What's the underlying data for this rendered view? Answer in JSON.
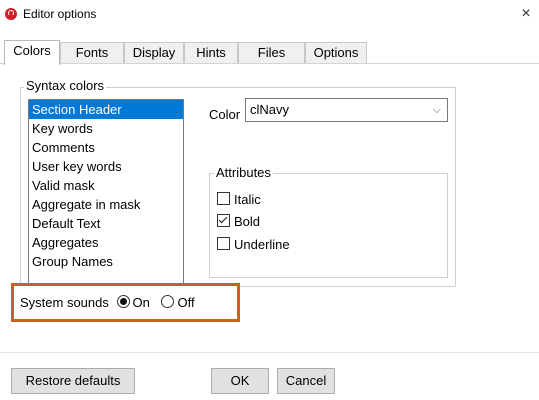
{
  "window": {
    "title": "Editor options",
    "close_symbol": "×"
  },
  "tabs": [
    {
      "label": "Colors",
      "active": true
    },
    {
      "label": "Fonts"
    },
    {
      "label": "Display"
    },
    {
      "label": "Hints"
    },
    {
      "label": "Files"
    },
    {
      "label": "Options"
    }
  ],
  "syntax_colors": {
    "group_label": "Syntax colors",
    "items": [
      "Section Header",
      "Key words",
      "Comments",
      "User key words",
      "Valid mask",
      "Aggregate in mask",
      "Default Text",
      "Aggregates",
      "Group Names"
    ],
    "selected_index": 0,
    "color_label": "Color",
    "color_value": "clNavy",
    "dropdown_symbol": "⌵"
  },
  "attributes": {
    "group_label": "Attributes",
    "italic": {
      "label": "Italic",
      "checked": false
    },
    "bold": {
      "label": "Bold",
      "checked": true
    },
    "underline": {
      "label": "Underline",
      "checked": false
    }
  },
  "system_sounds": {
    "label": "System sounds",
    "on_label": "On",
    "off_label": "Off",
    "selected": "On",
    "highlight_color": "#c8631e"
  },
  "buttons": {
    "restore": "Restore defaults",
    "ok": "OK",
    "cancel": "Cancel"
  },
  "colors": {
    "selection": "#0078d7",
    "app_icon": "#d21f2b"
  }
}
